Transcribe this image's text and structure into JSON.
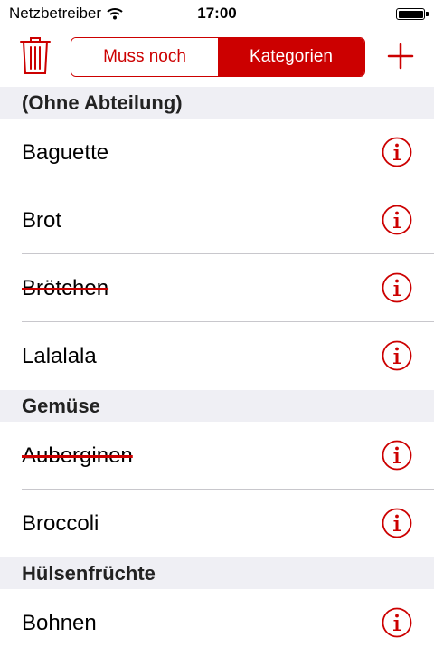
{
  "status_bar": {
    "carrier": "Netzbetreiber",
    "time": "17:00",
    "battery_level": 1.0
  },
  "toolbar": {
    "delete_icon": "trash-icon",
    "add_icon": "plus-icon",
    "accent_color": "#cc0000",
    "segments": [
      {
        "label": "Muss noch",
        "selected": false
      },
      {
        "label": "Kategorien",
        "selected": true
      }
    ]
  },
  "list": {
    "info_icon": "info-circle-icon",
    "sections": [
      {
        "title": "(Ohne Abteilung)",
        "items": [
          {
            "name": "Baguette",
            "done": false
          },
          {
            "name": "Brot",
            "done": false
          },
          {
            "name": "Brötchen",
            "done": true
          },
          {
            "name": "Lalalala",
            "done": false
          }
        ]
      },
      {
        "title": "Gemüse",
        "items": [
          {
            "name": "Auberginen",
            "done": true
          },
          {
            "name": "Broccoli",
            "done": false
          }
        ]
      },
      {
        "title": "Hülsenfrüchte",
        "items": [
          {
            "name": "Bohnen",
            "done": false
          }
        ]
      }
    ]
  }
}
